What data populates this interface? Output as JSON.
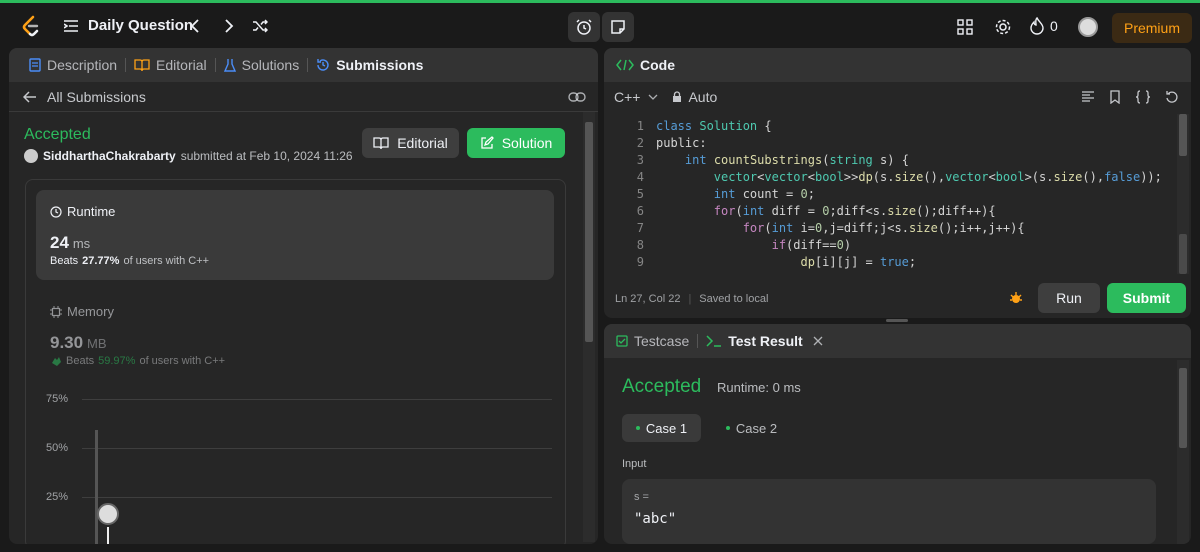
{
  "topbar": {
    "title": "Daily Question",
    "streak_count": "0",
    "premium_label": "Premium"
  },
  "left_panel": {
    "tabs": [
      "Description",
      "Editorial",
      "Solutions",
      "Submissions"
    ],
    "back_label": "All Submissions",
    "status": "Accepted",
    "user": "SiddharthaChakrabarty",
    "submitted_text": "submitted at Feb 10, 2024 11:26",
    "editorial_button": "Editorial",
    "solution_button": "Solution",
    "runtime": {
      "label": "Runtime",
      "value": "24",
      "unit": "ms",
      "beats_prefix": "Beats",
      "beats_pct": "27.77%",
      "beats_suffix": "of users with C++"
    },
    "memory": {
      "label": "Memory",
      "value": "9.30",
      "unit": "MB",
      "beats_prefix": "Beats",
      "beats_pct": "59.97%",
      "beats_suffix": "of users with C++"
    },
    "chart": {
      "y_ticks": [
        "75%",
        "50%",
        "25%"
      ]
    }
  },
  "code_panel": {
    "title": "Code",
    "language": "C++",
    "mode": "Auto",
    "status_position": "Ln 27, Col 22",
    "status_saved": "Saved to local",
    "run_label": "Run",
    "submit_label": "Submit",
    "lines": [
      {
        "n": "1",
        "t": "class Solution {"
      },
      {
        "n": "2",
        "t": "public:"
      },
      {
        "n": "3",
        "t": "    int countSubstrings(string s) {"
      },
      {
        "n": "4",
        "t": "        vector<vector<bool>>dp(s.size(),vector<bool>(s.size(),false));"
      },
      {
        "n": "5",
        "t": "        int count = 0;"
      },
      {
        "n": "6",
        "t": "        for(int diff = 0;diff<s.size();diff++){"
      },
      {
        "n": "7",
        "t": "            for(int i=0,j=diff;j<s.size();i++,j++){"
      },
      {
        "n": "8",
        "t": "                if(diff==0)"
      },
      {
        "n": "9",
        "t": "                    dp[i][j] = true;"
      }
    ]
  },
  "result_panel": {
    "tab_testcase": "Testcase",
    "tab_result": "Test Result",
    "status": "Accepted",
    "runtime": "Runtime: 0 ms",
    "cases": [
      "Case 1",
      "Case 2"
    ],
    "input_label": "Input",
    "var_label": "s =",
    "var_value": "\"abc\""
  },
  "colors": {
    "accent_green": "#2cbb5d",
    "premium_orange": "#ffa116"
  }
}
